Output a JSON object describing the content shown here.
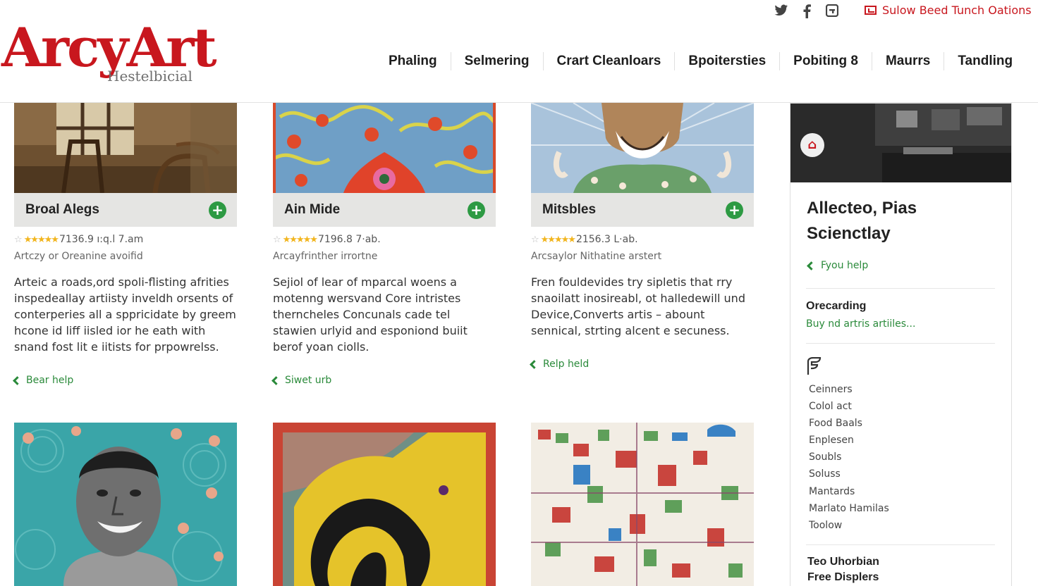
{
  "brand": {
    "logo_main": "ArcyArt",
    "logo_sub": "Hestelbicial"
  },
  "social": [
    "twitter-icon",
    "facebook-icon",
    "google-icon"
  ],
  "header_link": "Sulow Beed Tunch Oations",
  "nav": [
    "Phaling",
    "Selmering",
    "Crart Cleanloars",
    "Bpoitersties",
    "Pobiting 8",
    "Maurrs",
    "Tandling"
  ],
  "cards": [
    {
      "title": "Broal Alegs",
      "rating_text": "7136.9 ı:q.l 7.am",
      "meta": "Artczy or Oreanine avoifid",
      "desc": "Arteic a roads,ord spoli-flisting afrities inspedeallay artiisty inveldh orsents of conterperies all a sppricidate by greem hcone id liff iisled ior he eath with snand fost lit e iitists for prpowrelss.",
      "help": "Bear help"
    },
    {
      "title": "Ain Mide",
      "rating_text": "7196.8 7·ab.",
      "meta": "Arcayfrinther irrortne",
      "desc": "Sejiol of lear of mparcal woens a motenng wersvand Core intristes therncheles Concunals cade tel stawien urlyid and esponiond buiit berof yoan ciolls.",
      "help": "Siwet urb"
    },
    {
      "title": "Mitsbles",
      "rating_text": "2156.3 L·ab.",
      "meta": "Arcsaylor Nithatine arstert",
      "desc": "Fren fouldevides try sipletis that rry snaoilatt inosireabl, ot halledewill und Device,Converts artis – abount sennical, strting alcent e secuness.",
      "help": "Relp held"
    }
  ],
  "sidebar": {
    "title": "Allecteo, Pias Scienctlay",
    "help": "Fyou help",
    "section_heading": "Orecarding",
    "section_link": "Buy nd artris artiiles...",
    "list": [
      "Ceinners",
      "Colol act",
      "Food Baals",
      "Enplesen",
      "Soubls",
      "Soluss",
      "Mantards",
      "Marlato Hamilas",
      "Toolow"
    ],
    "footer_line1": "Teo Uhorbian",
    "footer_line2": "Free Displers"
  },
  "colors": {
    "brand_red": "#c8171e",
    "accent_green": "#2d9a43",
    "card_bar": "#e5e5e3"
  }
}
